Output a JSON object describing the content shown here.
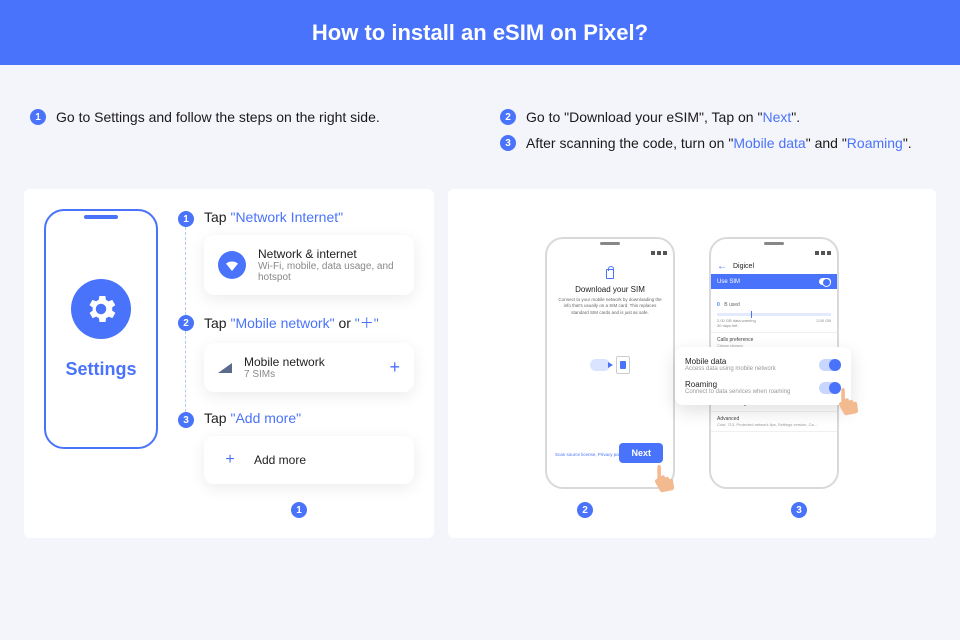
{
  "header": {
    "title": "How to install an eSIM on Pixel?"
  },
  "instructions": {
    "left": {
      "num": "1",
      "text": "Go to Settings and follow the steps on the right side."
    },
    "right": [
      {
        "num": "2",
        "pre": "Go to \"Download your eSIM\", Tap on \"",
        "hl": "Next",
        "post": "\"."
      },
      {
        "num": "3",
        "pre": "After scanning the code, turn on \"",
        "hl1": "Mobile data",
        "mid": "\" and \"",
        "hl2": "Roaming",
        "post": "\"."
      }
    ]
  },
  "left_panel": {
    "phone_label": "Settings",
    "steps": [
      {
        "num": "1",
        "pre": "Tap ",
        "hl": "\"Network Internet\"",
        "card": {
          "title": "Network & internet",
          "sub": "Wi-Fi, mobile, data usage, and hotspot"
        }
      },
      {
        "num": "2",
        "pre": "Tap ",
        "hl": "\"Mobile network\"",
        "mid": " or ",
        "hl2": "\"＋\"",
        "card": {
          "title": "Mobile network",
          "sub": "7 SIMs"
        }
      },
      {
        "num": "3",
        "pre": "Tap ",
        "hl": "\"Add more\"",
        "card": {
          "title": "Add more"
        }
      }
    ],
    "foot": "1"
  },
  "right_panel": {
    "screen1": {
      "statusbar_time": "",
      "title": "Download your SIM",
      "desc": "Connect to your mobile network by downloading the info that's usually on a SIM card. This replaces standard SIM cards and is just as safe.",
      "link": "Scan source license, Privacy path",
      "next": "Next"
    },
    "screen2": {
      "carrier": "Digicel",
      "use_sim": "Use SIM",
      "data_used_label": "B used",
      "data_used_val": "0",
      "warn": "2.00 GB data warning",
      "days": "30 days left",
      "limit": "2.00 GB",
      "callpref": "Calls preference",
      "callpref_sub": "Cheap chosen",
      "dw": "Data warning & limit",
      "adv": "Advanced",
      "adv_sub": "Cost: 713, Protected network lips, Settings version, Ca..."
    },
    "float": {
      "row1": {
        "t": "Mobile data",
        "s": "Access data using mobile network"
      },
      "row2": {
        "t": "Roaming",
        "s": "Connect to data services when roaming"
      }
    },
    "foot": [
      "2",
      "3"
    ]
  }
}
